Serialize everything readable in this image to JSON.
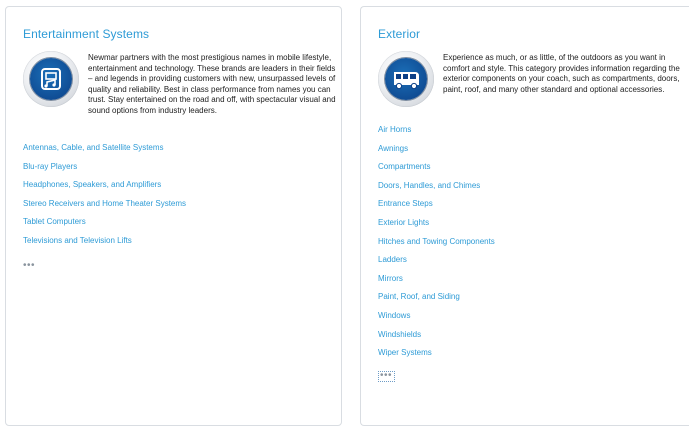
{
  "entertainment": {
    "title": "Entertainment Systems",
    "icon": "entertainment-icon",
    "description": "Newmar partners with the most prestigious names in mobile lifestyle, entertainment and technology. These brands are leaders in their fields – and legends in providing customers with new, unsurpassed levels of quality and reliability. Best in class performance from names you can trust. Stay entertained on the road and off, with spectacular visual and sound options from industry leaders.",
    "links": [
      "Antennas, Cable, and Satellite Systems",
      "Blu-ray Players",
      "Headphones, Speakers, and Amplifiers",
      "Stereo Receivers and Home Theater Systems",
      "Tablet Computers",
      "Televisions and Television Lifts"
    ],
    "more": "•••"
  },
  "exterior": {
    "title": "Exterior",
    "icon": "bus-icon",
    "description": "Experience as much, or as little, of the outdoors as you want in comfort and style. This category provides information regarding the exterior components on  your coach, such as compartments, doors, paint, roof, and many other standard and optional accessories.",
    "links": [
      "Air Horns",
      "Awnings",
      "Compartments",
      "Doors, Handles, and Chimes",
      "Entrance Steps",
      "Exterior Lights",
      "Hitches and Towing Components",
      "Ladders",
      "Mirrors",
      "Paint, Roof, and Siding",
      "Windows",
      "Windshields",
      "Wiper Systems"
    ],
    "more": "•••"
  },
  "colors": {
    "link": "#2e9bd6",
    "badge": "#0b3f86",
    "border": "#d9dde2"
  }
}
